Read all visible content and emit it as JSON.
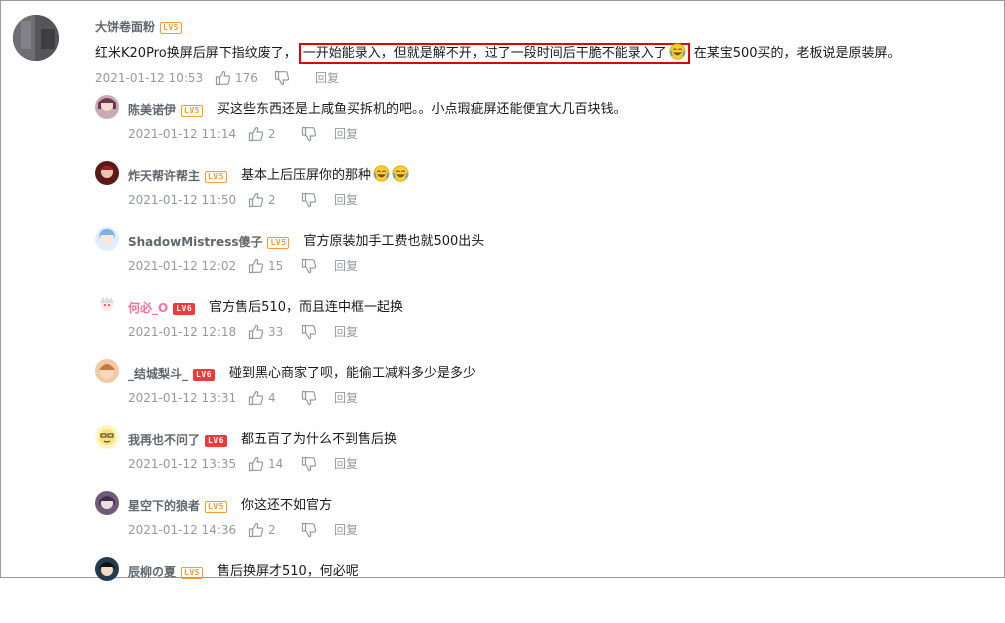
{
  "colors": {
    "highlight_box": "#e00000",
    "level_badge_lv5": "#ff9a2e",
    "level_badge_lv6": "#ee3a3a",
    "meta_text": "#9499a0",
    "pink_username": "#fb7299"
  },
  "main": {
    "username": "大饼卷面粉",
    "level": "LV5",
    "text_before": "红米K20Pro换屏后屏下指纹废了，",
    "text_highlight": "一开始能录入，但就是解不开，过了一段时间后干脆不能录入了",
    "text_after": "在某宝500买的，老板说是原装屏。",
    "emoji": "laugh-cry-emoji",
    "date": "2021-01-12 10:53",
    "likes": "176",
    "reply_label": "回复"
  },
  "replies": [
    {
      "username": "陈美诺伊",
      "level": "LV5",
      "text": "买这些东西还是上咸鱼买拆机的吧。。小点瑕疵屏还能便宜大几百块钱。",
      "date": "2021-01-12 11:14",
      "likes": "2",
      "reply_label": "回复"
    },
    {
      "username": "炸天帮许帮主",
      "level": "LV5",
      "text": "基本上后压屏你的那种",
      "emojis": [
        "laugh-cry-emoji",
        "laugh-cry-emoji"
      ],
      "date": "2021-01-12 11:50",
      "likes": "2",
      "reply_label": "回复"
    },
    {
      "username": "ShadowMistress傻子",
      "level": "LV5",
      "text": "官方原装加手工费也就500出头",
      "date": "2021-01-12 12:02",
      "likes": "15",
      "reply_label": "回复"
    },
    {
      "username": "何必_O",
      "level": "LV6",
      "text": "官方售后510，而且连中框一起换",
      "date": "2021-01-12 12:18",
      "likes": "33",
      "reply_label": "回复"
    },
    {
      "username": "_结城梨斗_",
      "level": "LV6",
      "text": "碰到黑心商家了呗，能偷工减料多少是多少",
      "date": "2021-01-12 13:31",
      "likes": "4",
      "reply_label": "回复"
    },
    {
      "username": "我再也不问了",
      "level": "LV6",
      "text": "都五百了为什么不到售后换",
      "date": "2021-01-12 13:35",
      "likes": "14",
      "reply_label": "回复"
    },
    {
      "username": "星空下的狼者",
      "level": "LV5",
      "text": "你这还不如官方",
      "date": "2021-01-12 14:36",
      "likes": "2",
      "reply_label": "回复"
    },
    {
      "username": "辰柳の夏",
      "level": "LV5",
      "text": "售后换屏才510，何必呢"
    }
  ]
}
